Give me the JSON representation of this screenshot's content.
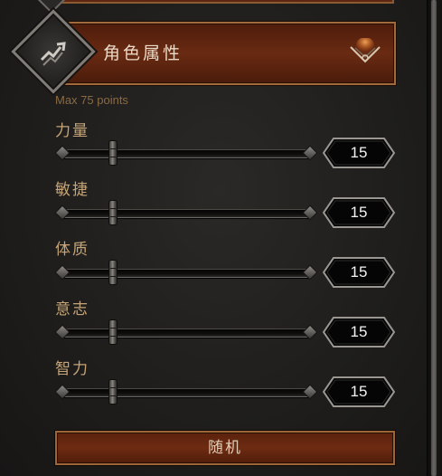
{
  "section": {
    "title": "角色属性",
    "max_points": "Max 75 points"
  },
  "attributes": [
    {
      "label": "力量",
      "value": "15",
      "level": 0.2
    },
    {
      "label": "敏捷",
      "value": "15",
      "level": 0.2
    },
    {
      "label": "体质",
      "value": "15",
      "level": 0.2
    },
    {
      "label": "意志",
      "value": "15",
      "level": 0.2
    },
    {
      "label": "智力",
      "value": "15",
      "level": 0.2
    }
  ],
  "random_button": {
    "label": "随机"
  },
  "colors": {
    "accent_red": "#692a12",
    "border_gold": "#a06a3c",
    "label_gold": "#c4a478",
    "value_white": "#f2f2f2"
  },
  "icons": {
    "section_icon": "stats-arrow-icon",
    "collapse_icon": "chevron-down-icon",
    "slider_end_icon": "diamond-end-icon"
  }
}
